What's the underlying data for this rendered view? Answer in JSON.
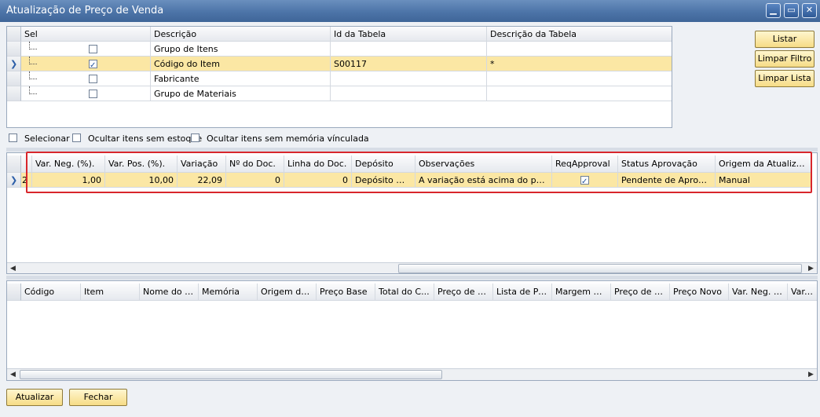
{
  "window": {
    "title": "Atualização de Preço de Venda",
    "min": "▁",
    "max": "▭",
    "close": "✕"
  },
  "icons": {
    "row_pointer": "chevron-right-icon",
    "check": "check-icon"
  },
  "criteria_grid": {
    "headers": [
      "Sel",
      "Descrição",
      "Id da Tabela",
      "Descrição da Tabela"
    ],
    "rows": [
      {
        "descricao": "Grupo de Itens",
        "id": "",
        "desc_tabela": "",
        "checked": false
      },
      {
        "descricao": "Código do Item",
        "id": "S00117",
        "desc_tabela": "*",
        "checked": true
      },
      {
        "descricao": "Fabricante",
        "id": "",
        "desc_tabela": "",
        "checked": false
      },
      {
        "descricao": "Grupo de Materiais",
        "id": "",
        "desc_tabela": "",
        "checked": false
      }
    ]
  },
  "side_buttons": {
    "listar": "Listar",
    "limpar_filtro": "Limpar Filtro",
    "limpar_lista": "Limpar Lista"
  },
  "options": {
    "selecionar": "Selecionar",
    "ocultar_estoque": "Ocultar itens sem estoque",
    "ocultar_memoria": "Ocultar itens sem memória vínculada"
  },
  "variation_grid": {
    "first_col_fragment": "2",
    "headers": [
      "Var. Neg. (%).",
      "Var. Pos. (%).",
      "Variação",
      "Nº do Doc.",
      "Linha do Doc.",
      "Depósito",
      "Observações",
      "ReqApproval",
      "Status Aprovação",
      "Origem da Atualização"
    ],
    "row": {
      "var_neg": "1,00",
      "var_pos": "10,00",
      "variacao": "22,09",
      "num_doc": "0",
      "linha_doc": "0",
      "deposito": "Depósito Matriz",
      "observacoes": "A variação está acima do permitido",
      "req_approval": true,
      "status": "Pendente de Aprovação",
      "origem": "Manual"
    }
  },
  "items_grid": {
    "headers": [
      "Código",
      "Item",
      "Nome do It...",
      "Memória",
      "Origem do ...",
      "Preço Base",
      "Total do C...",
      "Preço de C...",
      "Lista de Pr...",
      "Margem de...",
      "Preço de A...",
      "Preço Novo",
      "Var. Neg. (...",
      "Var. Po"
    ]
  },
  "footer_buttons": {
    "atualizar": "Atualizar",
    "fechar": "Fechar"
  }
}
